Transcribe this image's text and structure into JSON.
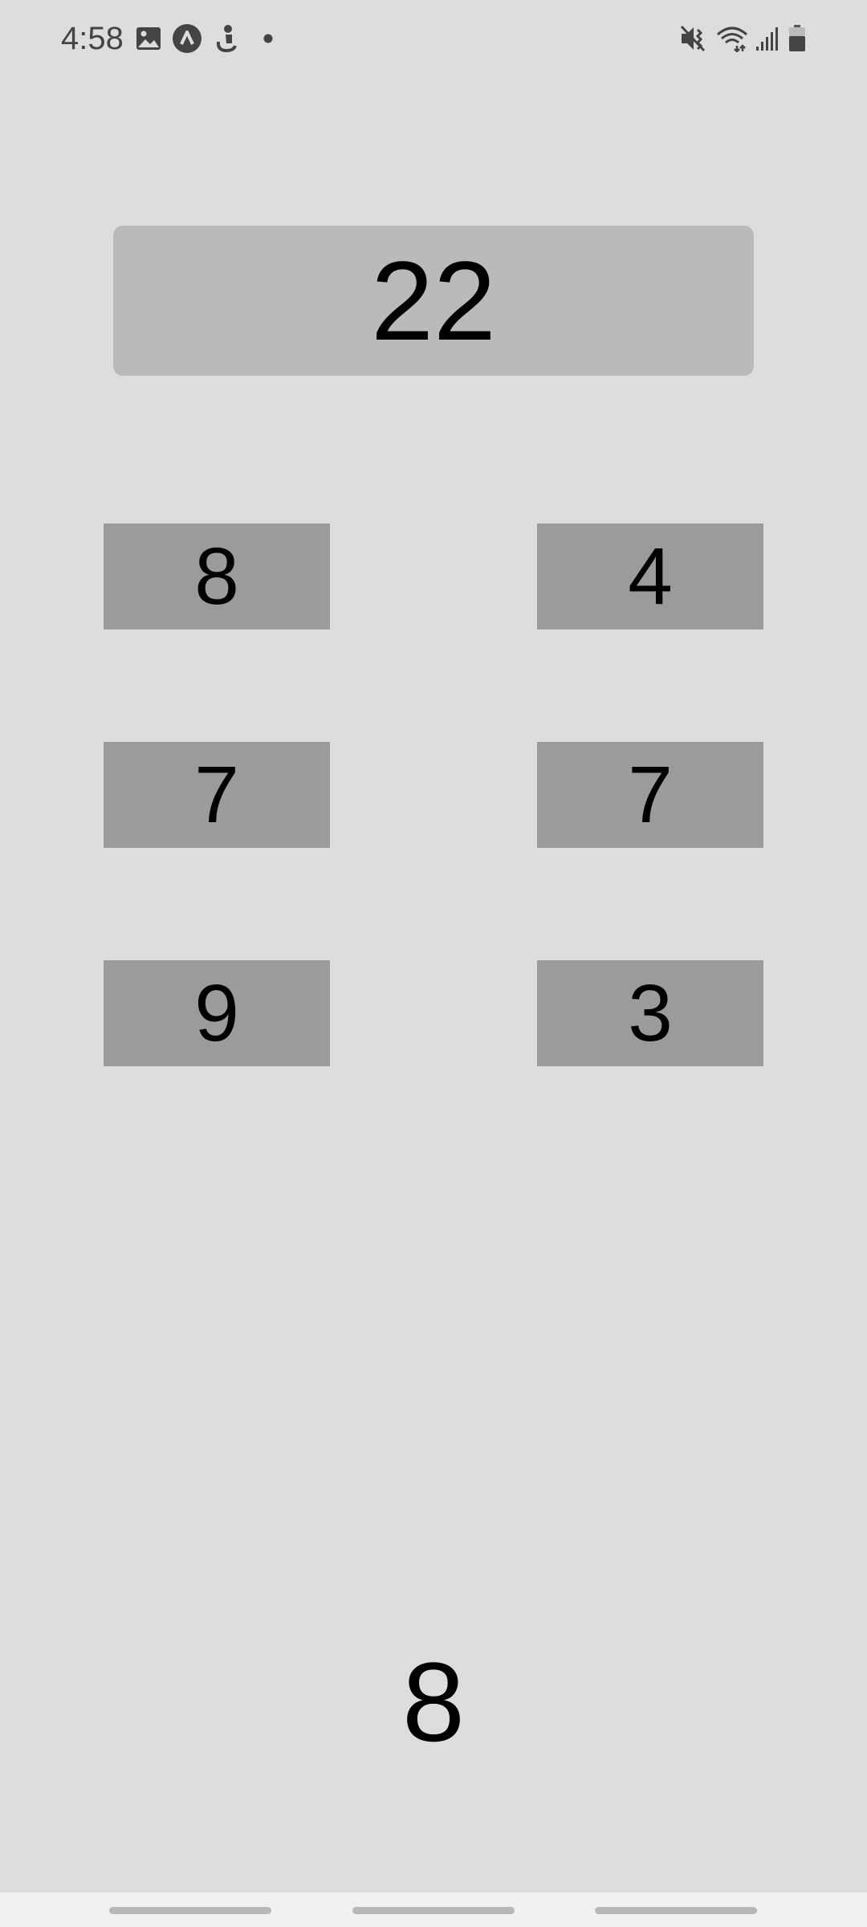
{
  "status_bar": {
    "time": "4:58",
    "icons": [
      "gallery-icon",
      "app-circle-icon",
      "accessibility-icon",
      "notification-dot-icon",
      "mute-vibrate-icon",
      "wifi-icon",
      "signal-icon",
      "battery-icon"
    ]
  },
  "game": {
    "target": "22",
    "tiles": [
      "8",
      "4",
      "7",
      "7",
      "9",
      "3"
    ],
    "current": "8"
  },
  "colors": {
    "background": "#dddddd",
    "target_panel": "#bababa",
    "tile": "#9b9b9b",
    "nav_bar": "#f1f1f1"
  }
}
